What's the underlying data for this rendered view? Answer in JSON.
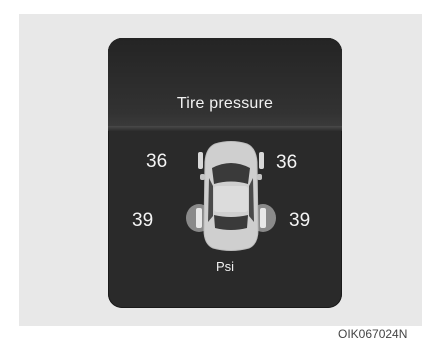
{
  "display": {
    "title": "Tire pressure",
    "unit": "Psi",
    "tires": {
      "front_left": "36",
      "front_right": "36",
      "rear_left": "39",
      "rear_right": "39"
    }
  },
  "caption": "OIK067024N"
}
